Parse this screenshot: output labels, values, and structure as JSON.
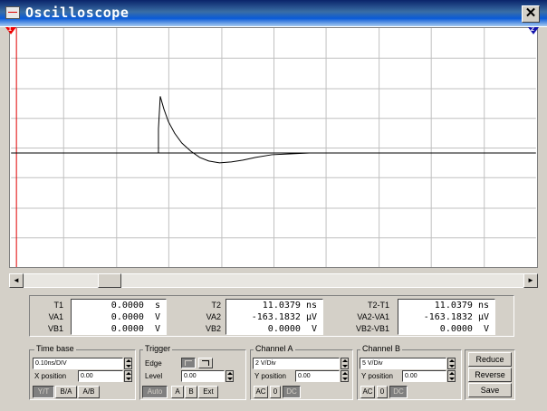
{
  "window": {
    "title": "Oscilloscope",
    "close_glyph": "✕"
  },
  "screen": {
    "markers": {
      "t1_label": "1",
      "t2_label": "2",
      "t1_color": "#e00000",
      "t2_color": "#1111aa"
    },
    "grid_color": "#c0c0c0",
    "trace_color": "#000000"
  },
  "scrollbar": {
    "left_arrow": "◄",
    "right_arrow": "►"
  },
  "readout": {
    "col1": {
      "labels": [
        "T1",
        "VA1",
        "VB1"
      ],
      "values": [
        " 0.0000  s",
        " 0.0000  V",
        " 0.0000  V"
      ]
    },
    "col2": {
      "labels": [
        "T2",
        "VA2",
        "VB2"
      ],
      "values": [
        "11.0379 ns",
        "-163.1832 µV",
        " 0.0000  V"
      ]
    },
    "col3": {
      "labels": [
        "T2-T1",
        "VA2-VA1",
        "VB2-VB1"
      ],
      "values": [
        "11.0379 ns",
        "-163.1832 µV",
        " 0.0000  V"
      ]
    }
  },
  "timebase": {
    "label": "Time base",
    "value": "0.10ns/DIV",
    "xpos_label": "X position",
    "xpos_value": "0.00",
    "modes": [
      "Y/T",
      "B/A",
      "A/B"
    ]
  },
  "trigger": {
    "label": "Trigger",
    "edge_label": "Edge",
    "level_label": "Level",
    "level_value": "0.00",
    "buttons": [
      "Auto",
      "A",
      "B",
      "Ext"
    ]
  },
  "channel_a": {
    "label": "Channel A",
    "value": "2 V/Div",
    "ypos_label": "Y position",
    "ypos_value": "0.00",
    "coupling": [
      "AC",
      "0",
      "DC"
    ]
  },
  "channel_b": {
    "label": "Channel B",
    "value": "5 V/Div",
    "ypos_label": "Y position",
    "ypos_value": "0.00",
    "coupling": [
      "AC",
      "0",
      "DC"
    ]
  },
  "actions": {
    "reduce": "Reduce",
    "reverse": "Reverse",
    "save": "Save"
  }
}
